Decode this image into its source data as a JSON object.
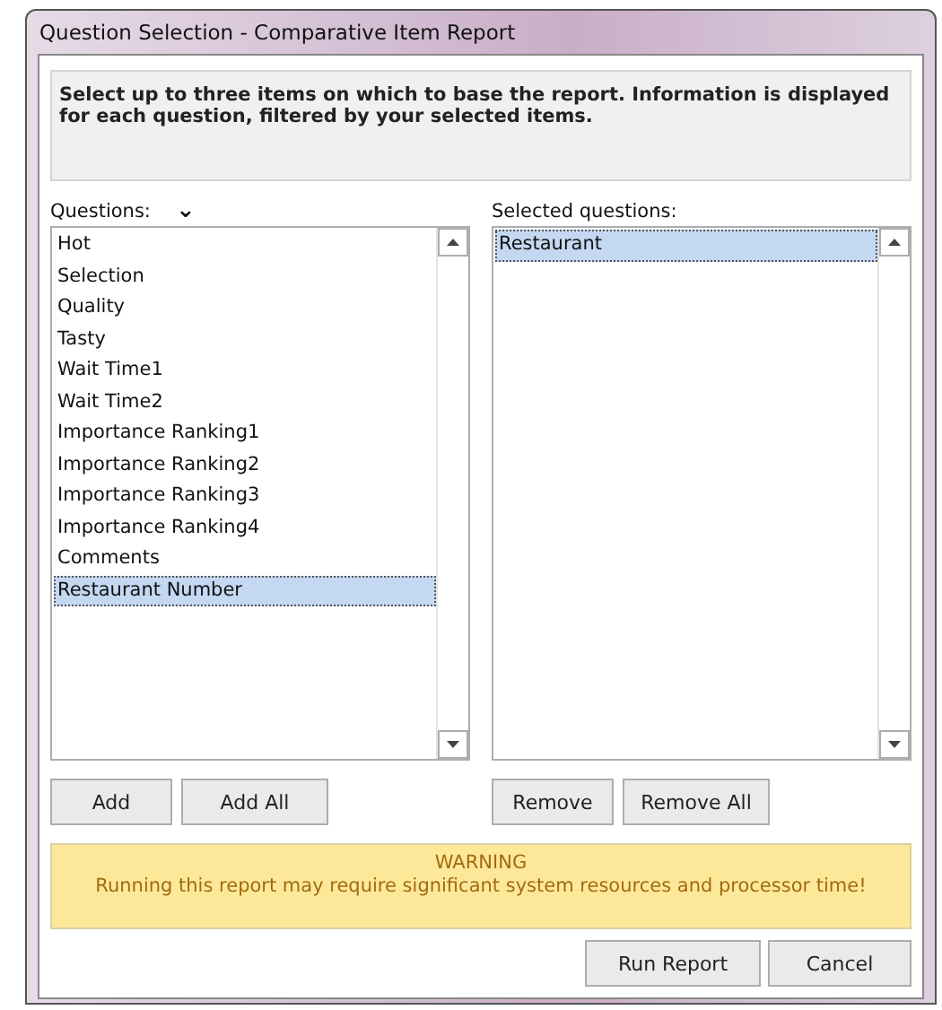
{
  "window": {
    "title": "Question Selection - Comparative Item Report"
  },
  "instructions": "Select up to three items on which to base the report. Information is displayed for each question, filtered by your selected items.",
  "questions": {
    "label": "Questions:",
    "dropdown_glyph": "⌄",
    "items": [
      {
        "text": "Hot",
        "selected": false
      },
      {
        "text": "Selection",
        "selected": false
      },
      {
        "text": "Quality",
        "selected": false
      },
      {
        "text": "Tasty",
        "selected": false
      },
      {
        "text": "Wait Time1",
        "selected": false
      },
      {
        "text": "Wait Time2",
        "selected": false
      },
      {
        "text": "Importance Ranking1",
        "selected": false
      },
      {
        "text": "Importance Ranking2",
        "selected": false
      },
      {
        "text": "Importance Ranking3",
        "selected": false
      },
      {
        "text": "Importance Ranking4",
        "selected": false
      },
      {
        "text": "Comments",
        "selected": false
      },
      {
        "text": "Restaurant Number",
        "selected": true
      }
    ],
    "buttons": [
      "Add",
      "Add All"
    ]
  },
  "selected_questions": {
    "label": "Selected questions:",
    "items": [
      {
        "text": "Restaurant",
        "selected": true
      }
    ],
    "buttons": [
      "Remove",
      "Remove All"
    ]
  },
  "warning": {
    "title": "WARNING",
    "message": "Running this report may require significant system resources and processor time!"
  },
  "buttons": [
    "Run Report",
    "Cancel"
  ]
}
